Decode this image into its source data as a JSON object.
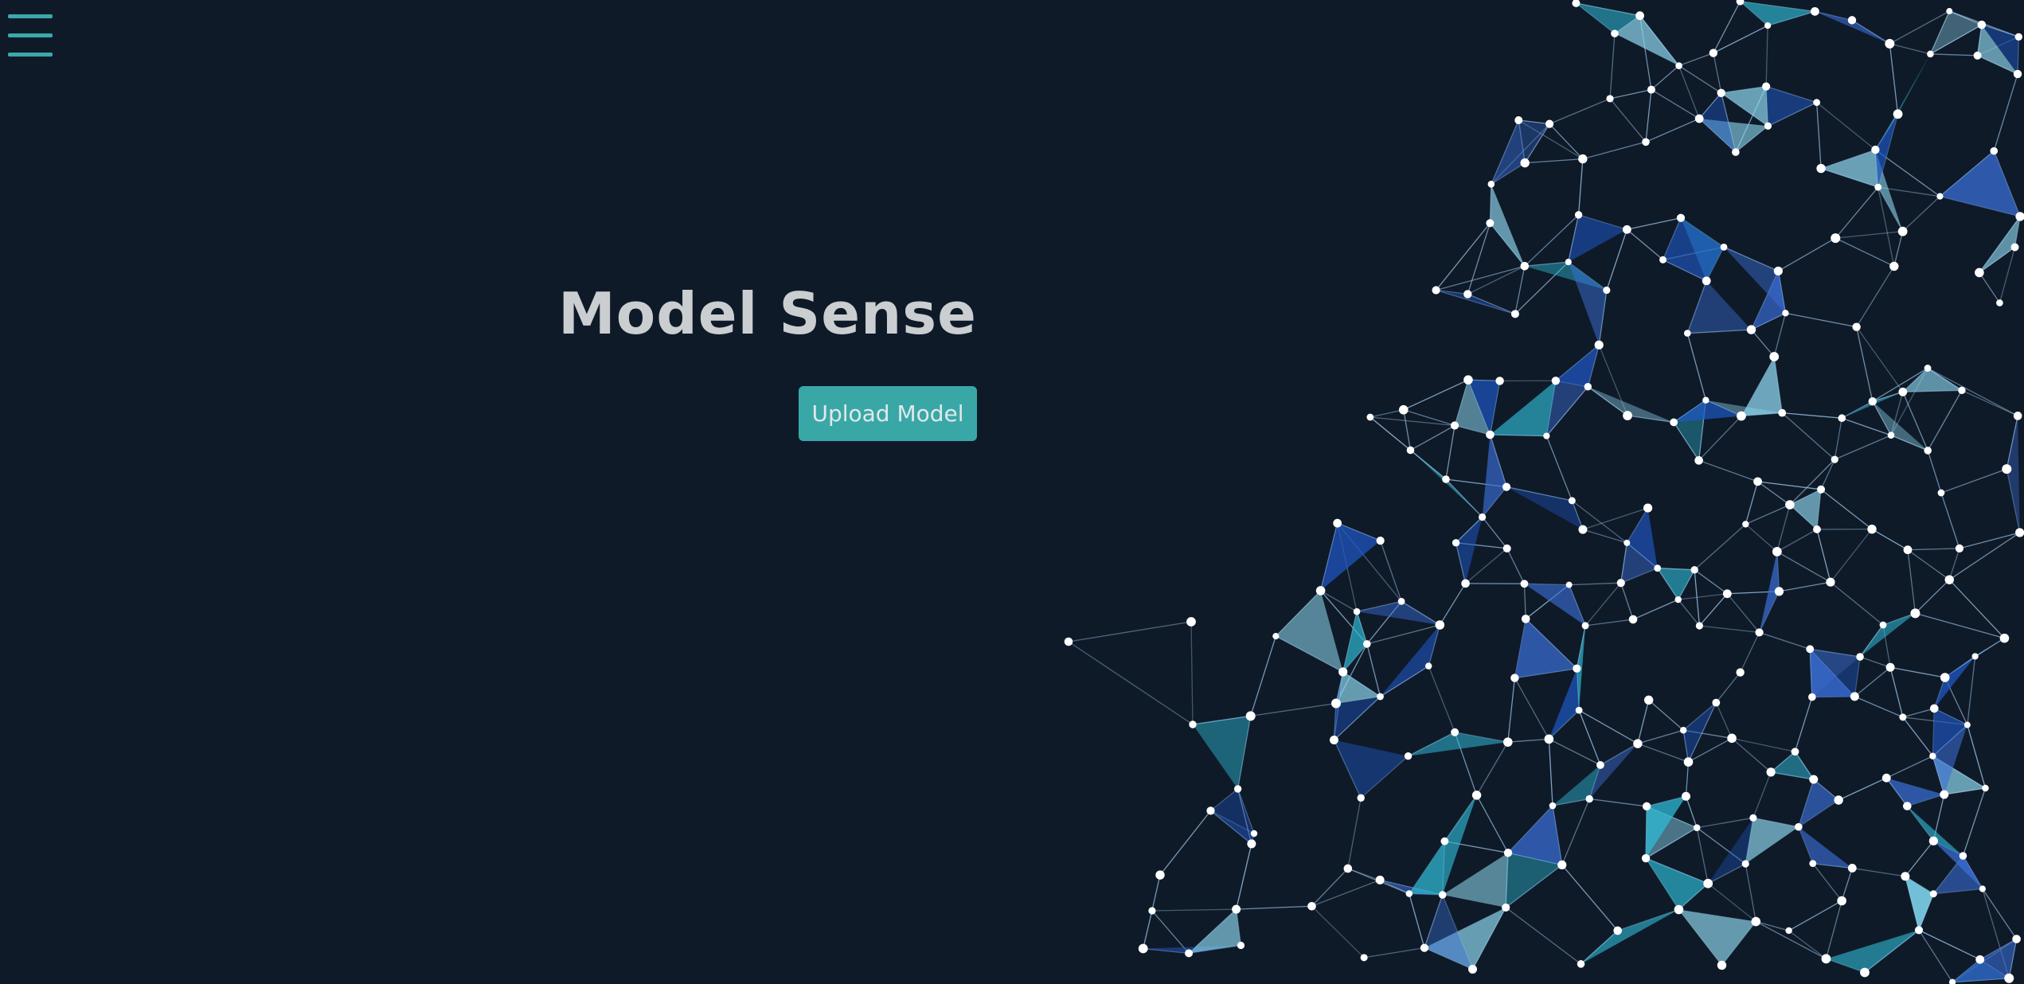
{
  "header": {
    "menu_icon": "hamburger-menu-icon",
    "accent_color": "#3aa9ac"
  },
  "hero": {
    "title": "Model Sense",
    "upload_button_label": "Upload Model",
    "button_color": "#3aa7a7",
    "background_color": "#0f1a28"
  },
  "decoration": {
    "image": "network-graph-illustration",
    "node_color": "#ffffff",
    "edge_color": "#9fc7ea",
    "fill_colors": [
      "#1f58c7",
      "#2fb9d5",
      "#8fd8f0",
      "#3a6fd8"
    ]
  }
}
